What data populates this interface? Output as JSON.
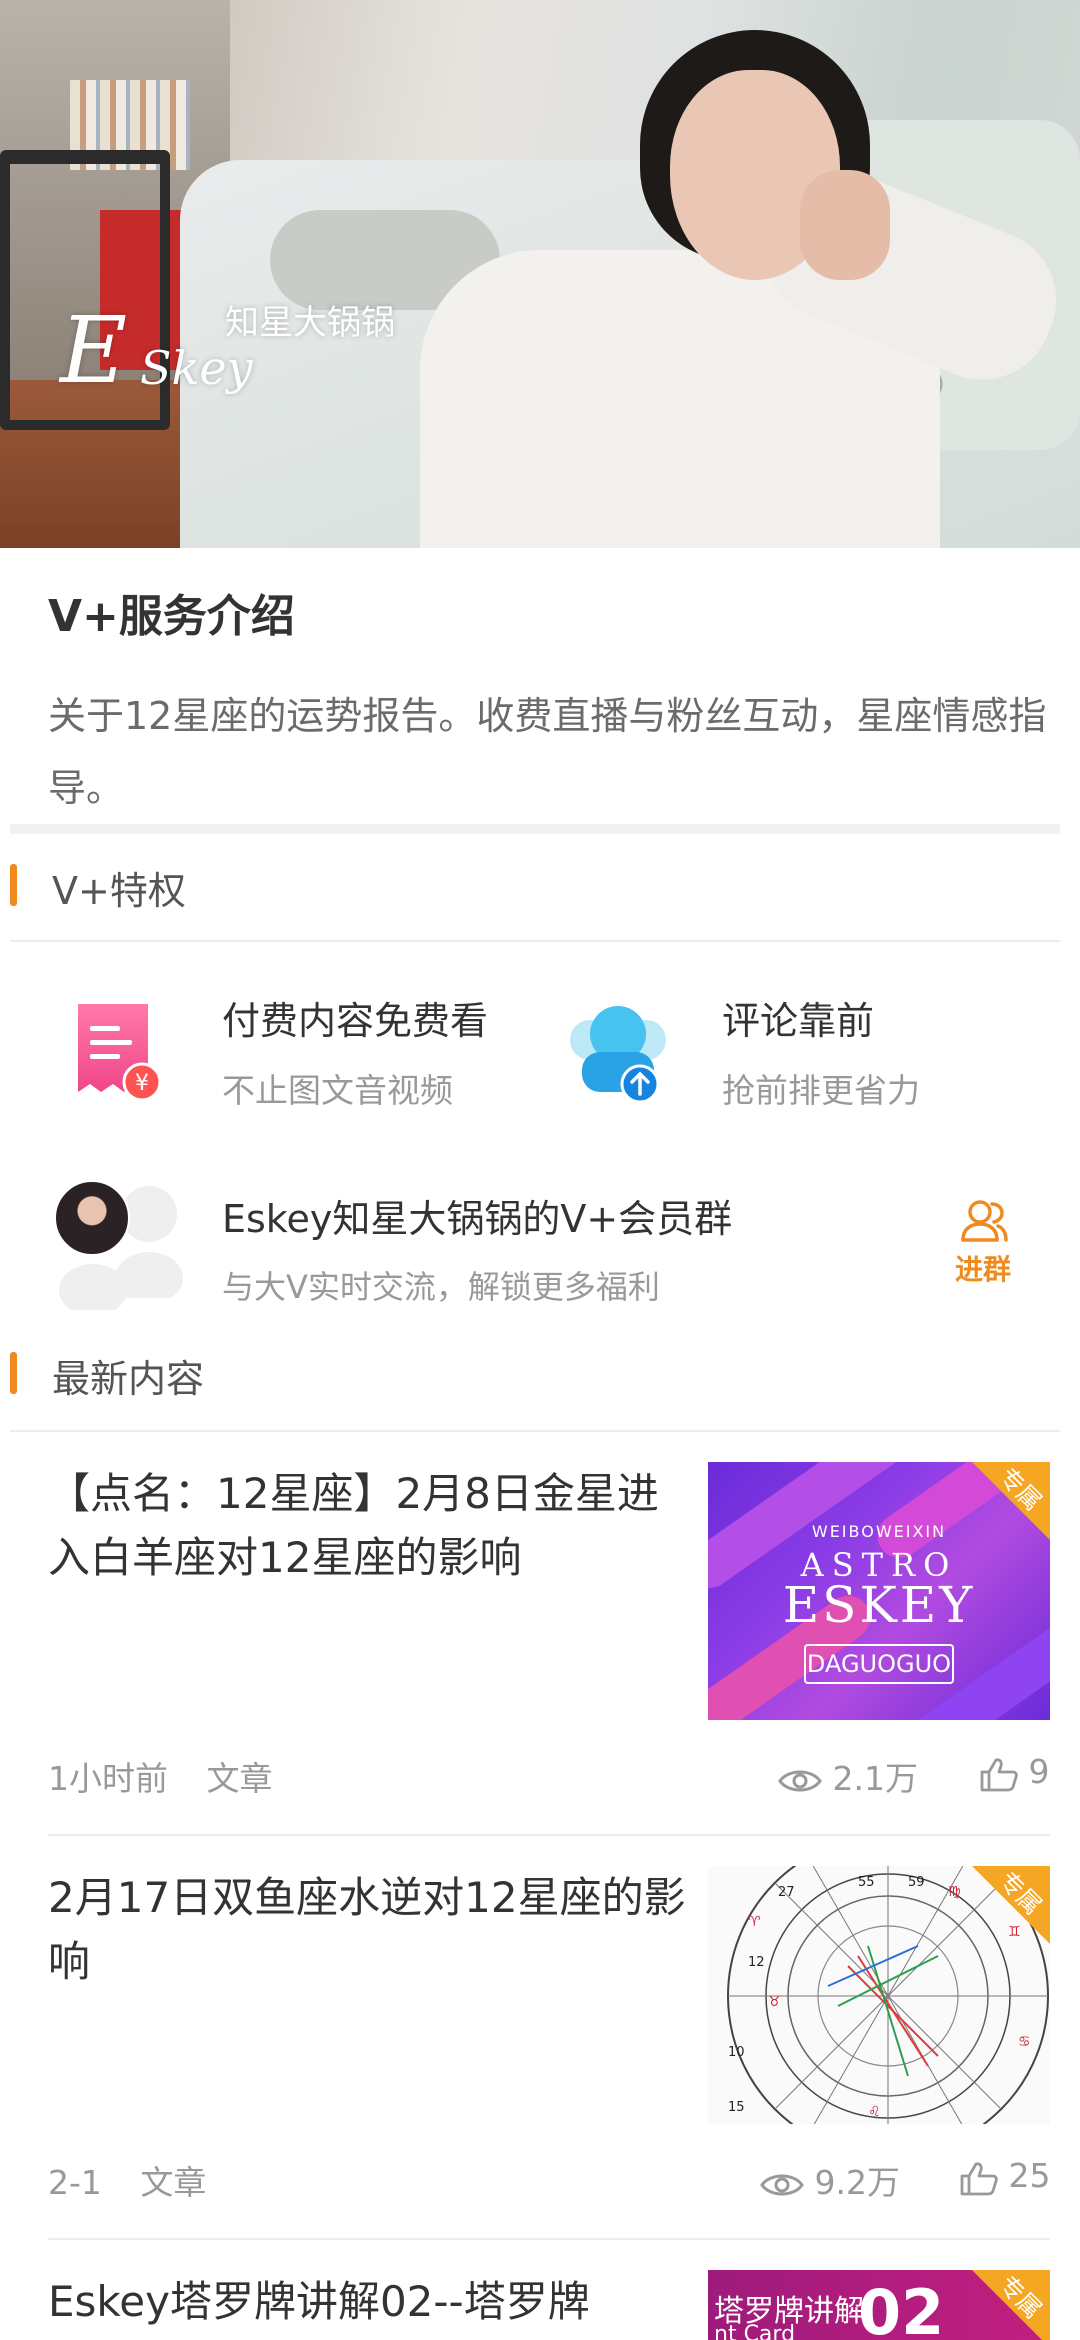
{
  "hero": {
    "logo_mark": "E",
    "logo_cn": "知星大锅锅",
    "logo_en": "Skey"
  },
  "service": {
    "title": "V+服务介绍",
    "description": "关于12星座的运势报告。收费直播与粉丝互动，星座情感指导。"
  },
  "privileges": {
    "header": "V+特权",
    "items": [
      {
        "title": "付费内容免费看",
        "subtitle": "不止图文音视频",
        "icon": "paid-content-icon"
      },
      {
        "title": "评论靠前",
        "subtitle": "抢前排更省力",
        "icon": "comment-priority-icon"
      }
    ]
  },
  "group": {
    "title": "Eskey知星大锅锅的V+会员群",
    "subtitle": "与大V实时交流，解锁更多福利",
    "join_label": "进群"
  },
  "latest": {
    "header": "最新内容",
    "articles": [
      {
        "title": "【点名：12星座】2月8日金星进入白羊座对12星座的影响",
        "time": "1小时前",
        "type": "文章",
        "views": "2.1万",
        "likes": "9",
        "badge": "专属",
        "thumb": {
          "small": "WEIBOWEIXIN",
          "astro": "ASTRO",
          "main": "ESKEY",
          "box": "DAGUOGUO"
        }
      },
      {
        "title": "2月17日双鱼座水逆对12星座的影响",
        "time": "2-1",
        "type": "文章",
        "views": "9.2万",
        "likes": "25",
        "badge": "专属"
      },
      {
        "title": "Eskey塔罗牌讲解02--塔罗牌",
        "badge": "专属",
        "thumb": {
          "a": "塔罗牌讲解",
          "b": "02",
          "c": "nt Card"
        }
      }
    ]
  },
  "colors": {
    "accent": "#f08a1e",
    "badge": "#f5a623",
    "text": "#333333",
    "muted": "#999999"
  }
}
